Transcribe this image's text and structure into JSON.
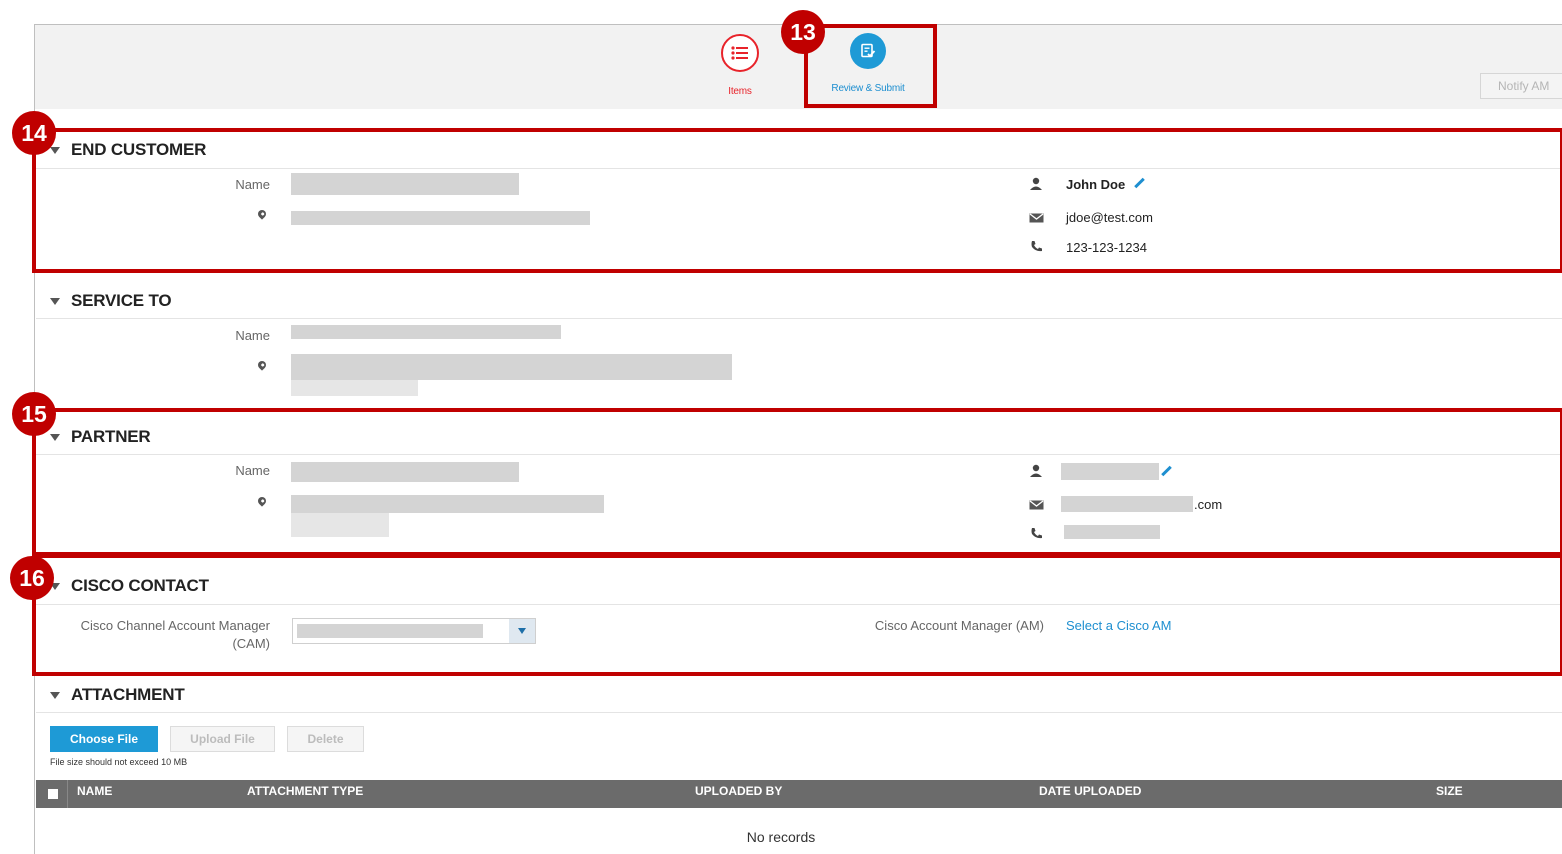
{
  "wizard": {
    "steps": [
      {
        "label": "Items"
      },
      {
        "label": "Review & Submit"
      }
    ],
    "notify_label": "Notify AM"
  },
  "end_customer": {
    "title": "END CUSTOMER",
    "name_label": "Name",
    "contact_name": "John Doe",
    "email": "jdoe@test.com",
    "phone": "123-123-1234"
  },
  "service_to": {
    "title": "SERVICE TO",
    "name_label": "Name"
  },
  "partner": {
    "title": "PARTNER",
    "name_label": "Name",
    "email_suffix": ".com"
  },
  "cisco_contact": {
    "title": "CISCO CONTACT",
    "cam_label_line1": "Cisco Channel Account Manager",
    "cam_label_line2": "(CAM)",
    "am_label": "Cisco Account Manager (AM)",
    "am_link": "Select a Cisco AM"
  },
  "attachment": {
    "title": "ATTACHMENT",
    "choose_label": "Choose File",
    "upload_label": "Upload File",
    "delete_label": "Delete",
    "hint": "File size should not exceed 10 MB",
    "columns": [
      "NAME",
      "ATTACHMENT TYPE",
      "UPLOADED BY",
      "DATE UPLOADED",
      "SIZE"
    ],
    "empty_text": "No records"
  },
  "annotations": {
    "n13": "13",
    "n14": "14",
    "n15": "15",
    "n16": "16"
  },
  "colors": {
    "annotation": "#c00000",
    "accent": "#1e9ad6",
    "items_red": "#e8232a"
  }
}
